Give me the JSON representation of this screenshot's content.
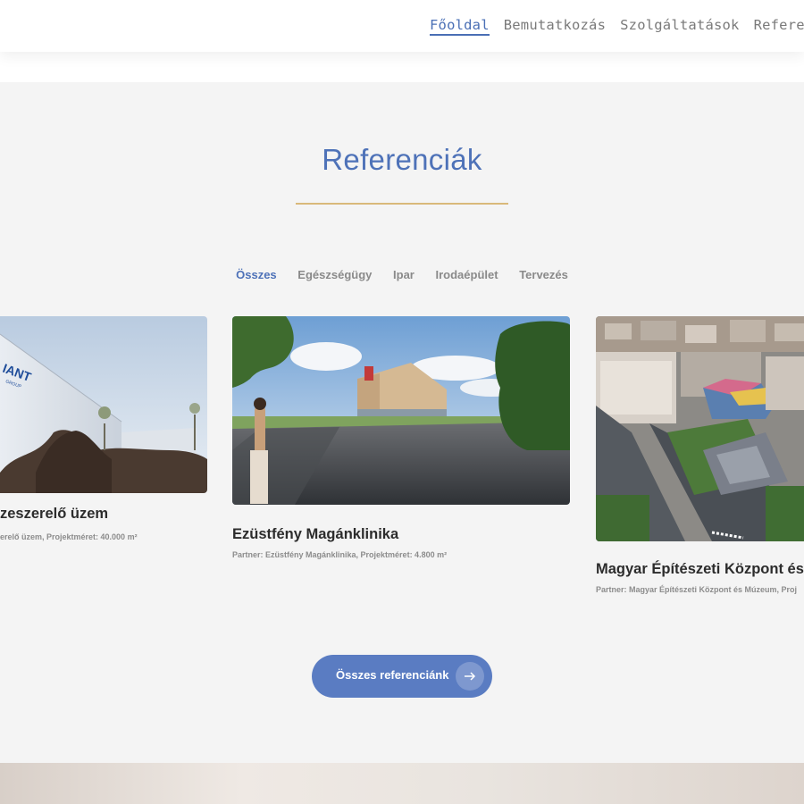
{
  "nav": {
    "items": [
      {
        "label": "Főoldal",
        "active": true
      },
      {
        "label": "Bemutatkozás",
        "active": false
      },
      {
        "label": "Szolgáltatások",
        "active": false
      },
      {
        "label": "Referen",
        "active": false
      }
    ]
  },
  "section": {
    "title": "Referenciák",
    "accent_line_color": "#d9b97a",
    "title_color": "#4e72b8"
  },
  "filters": [
    {
      "label": "Összes",
      "active": true
    },
    {
      "label": "Egészségügy",
      "active": false
    },
    {
      "label": "Ipar",
      "active": false
    },
    {
      "label": "Irodaépület",
      "active": false
    },
    {
      "label": "Tervezés",
      "active": false
    }
  ],
  "cards": [
    {
      "title": "zeszerelő üzem",
      "subtitle": "erelő üzem, Projektméret: 40.000 m²",
      "sign_text": "IANT",
      "sign_subtext": "GROUP"
    },
    {
      "title": "Ezüstfény Magánklinika",
      "subtitle": "Partner: Ezüstfény Magánklinika, Projektméret: 4.800 m²"
    },
    {
      "title": "Magyar Építészeti Központ és Mú",
      "subtitle": "Partner: Magyar Építészeti Központ és Múzeum, Proj"
    }
  ],
  "cta": {
    "label": "Összes referenciánk",
    "icon": "arrow-right-icon",
    "color": "#5a7cc2"
  }
}
